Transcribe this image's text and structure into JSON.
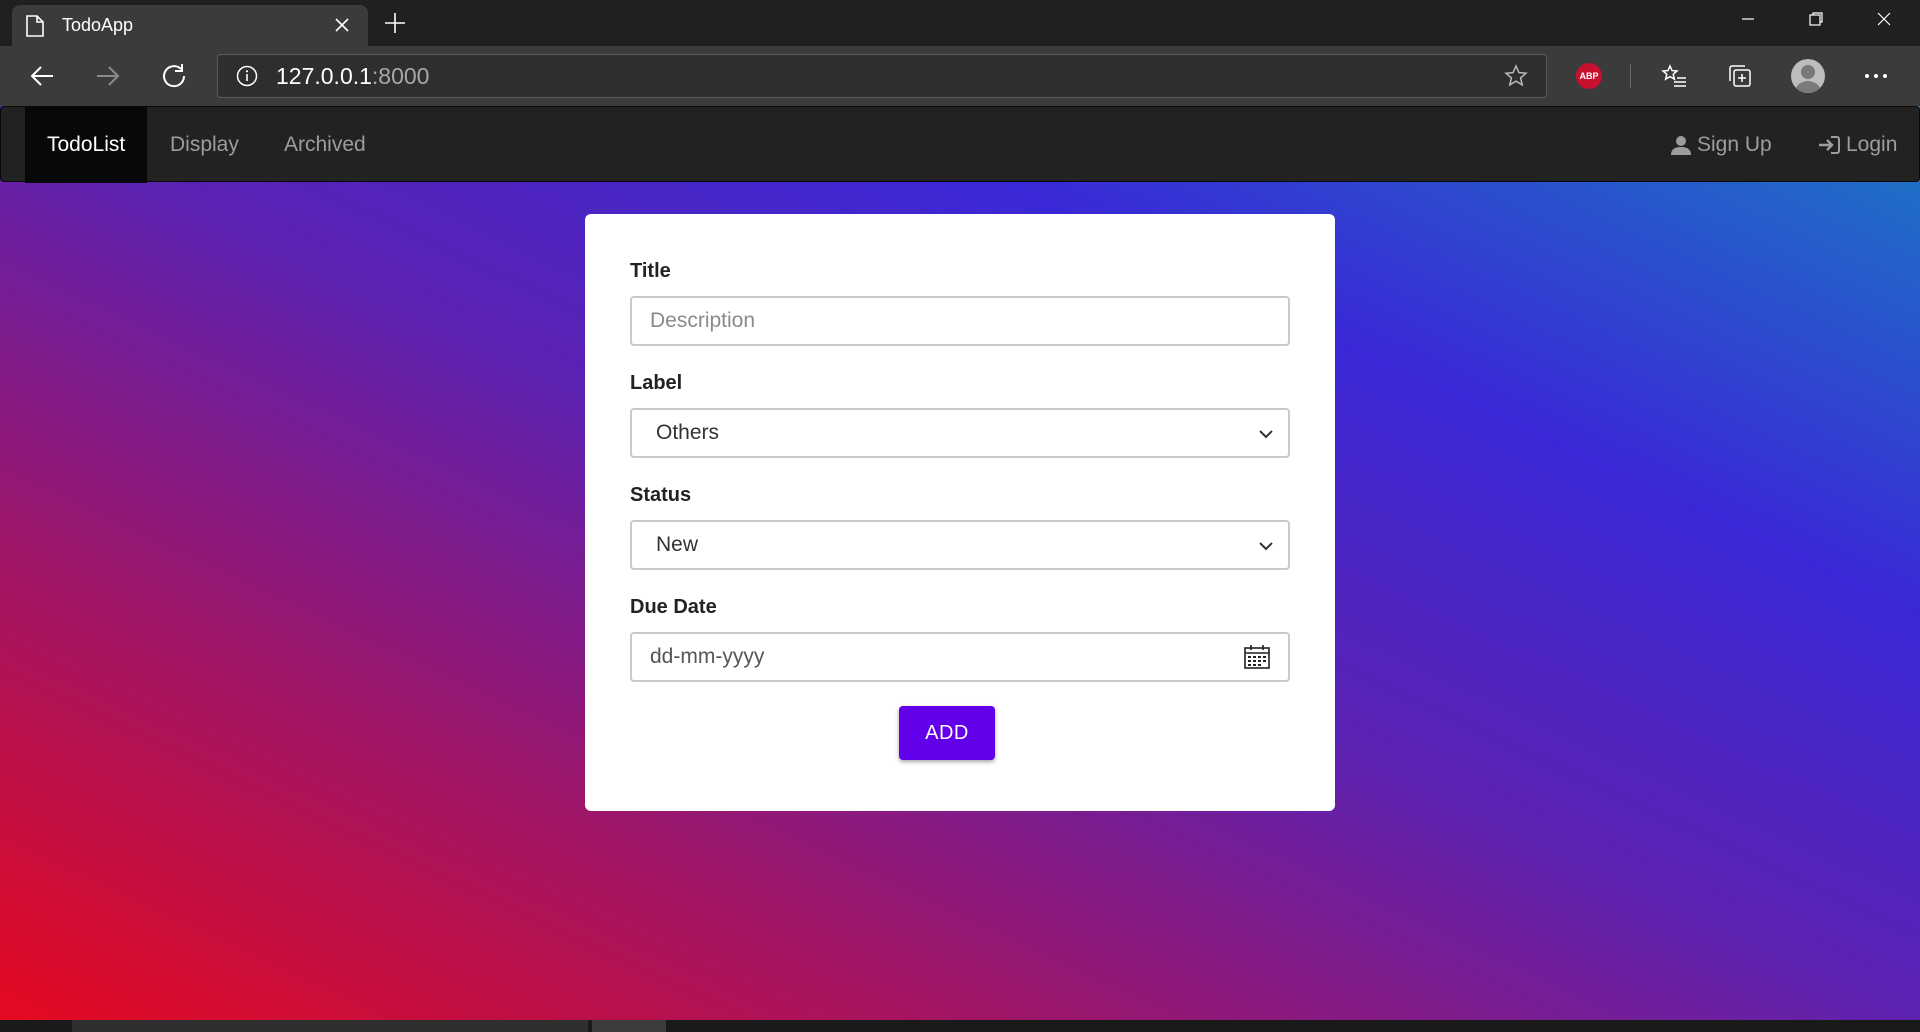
{
  "browser": {
    "tab_title": "TodoApp",
    "url_host": "127.0.0.1",
    "url_port": ":8000",
    "abp_label": "ABP"
  },
  "app_nav": {
    "brand": "TodoList",
    "links": [
      "Display",
      "Archived"
    ],
    "signup": "Sign Up",
    "login": "Login"
  },
  "form": {
    "title_label": "Title",
    "title_placeholder": "Description",
    "label_label": "Label",
    "label_value": "Others",
    "status_label": "Status",
    "status_value": "New",
    "due_label": "Due Date",
    "due_placeholder": "dd-mm-yyyy",
    "add_button": "ADD"
  },
  "colors": {
    "accent": "#6200ea",
    "nav_bg": "#222222"
  }
}
